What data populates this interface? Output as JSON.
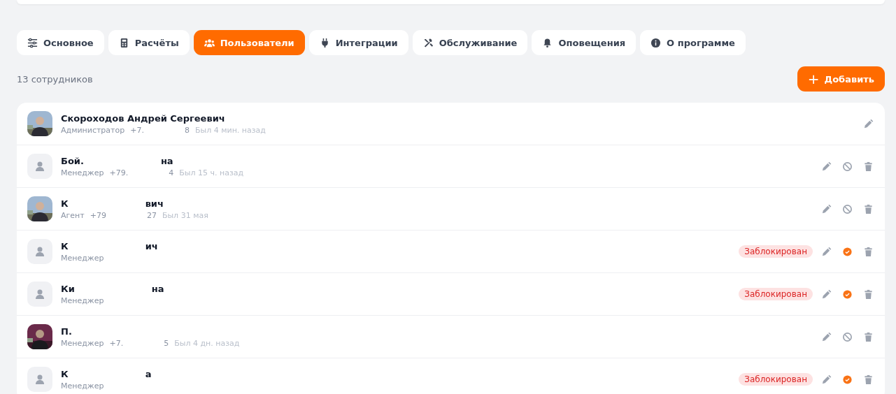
{
  "tabs": [
    {
      "label": "Основное",
      "selected": false
    },
    {
      "label": "Расчёты",
      "selected": false
    },
    {
      "label": "Пользователи",
      "selected": true
    },
    {
      "label": "Интеграции",
      "selected": false
    },
    {
      "label": "Обслуживание",
      "selected": false
    },
    {
      "label": "Оповещения",
      "selected": false
    },
    {
      "label": "О программе",
      "selected": false
    }
  ],
  "employee_count": "13 сотрудников",
  "add_button": {
    "icon": "+",
    "label": "Добавить"
  },
  "users": [
    {
      "name_parts": [
        "Скороходов Андрей Сергеевич"
      ],
      "role": "Администратор",
      "phone_parts": [
        "+7.",
        "8"
      ],
      "last_seen": "Был 4 мин. назад",
      "blocked": false,
      "deletable": false
    },
    {
      "name_parts": [
        "Бой.",
        "на"
      ],
      "role": "Менеджер",
      "phone_parts": [
        "+79.",
        "4"
      ],
      "last_seen": "Был 15 ч. назад",
      "blocked": false,
      "deletable": true
    },
    {
      "name_parts": [
        "К",
        "вич"
      ],
      "role": "Агент",
      "phone_parts": [
        "+79",
        "27"
      ],
      "last_seen": "Был 31 мая",
      "blocked": false,
      "deletable": true
    },
    {
      "name_parts": [
        "К",
        "ич"
      ],
      "role": "Менеджер",
      "blocked": true,
      "badge": "Заблокирован",
      "deletable": true
    },
    {
      "name_parts": [
        "Ки",
        "на"
      ],
      "role": "Менеджер",
      "blocked": true,
      "badge": "Заблокирован",
      "deletable": true
    },
    {
      "name_parts": [
        "П."
      ],
      "role": "Менеджер",
      "phone_parts": [
        "+7.",
        "5"
      ],
      "last_seen": "Был 4 дн. назад",
      "blocked": false,
      "deletable": true
    },
    {
      "name_parts": [
        "К",
        "а"
      ],
      "role": "Менеджер",
      "blocked": true,
      "badge": "Заблокирован",
      "deletable": true
    }
  ]
}
